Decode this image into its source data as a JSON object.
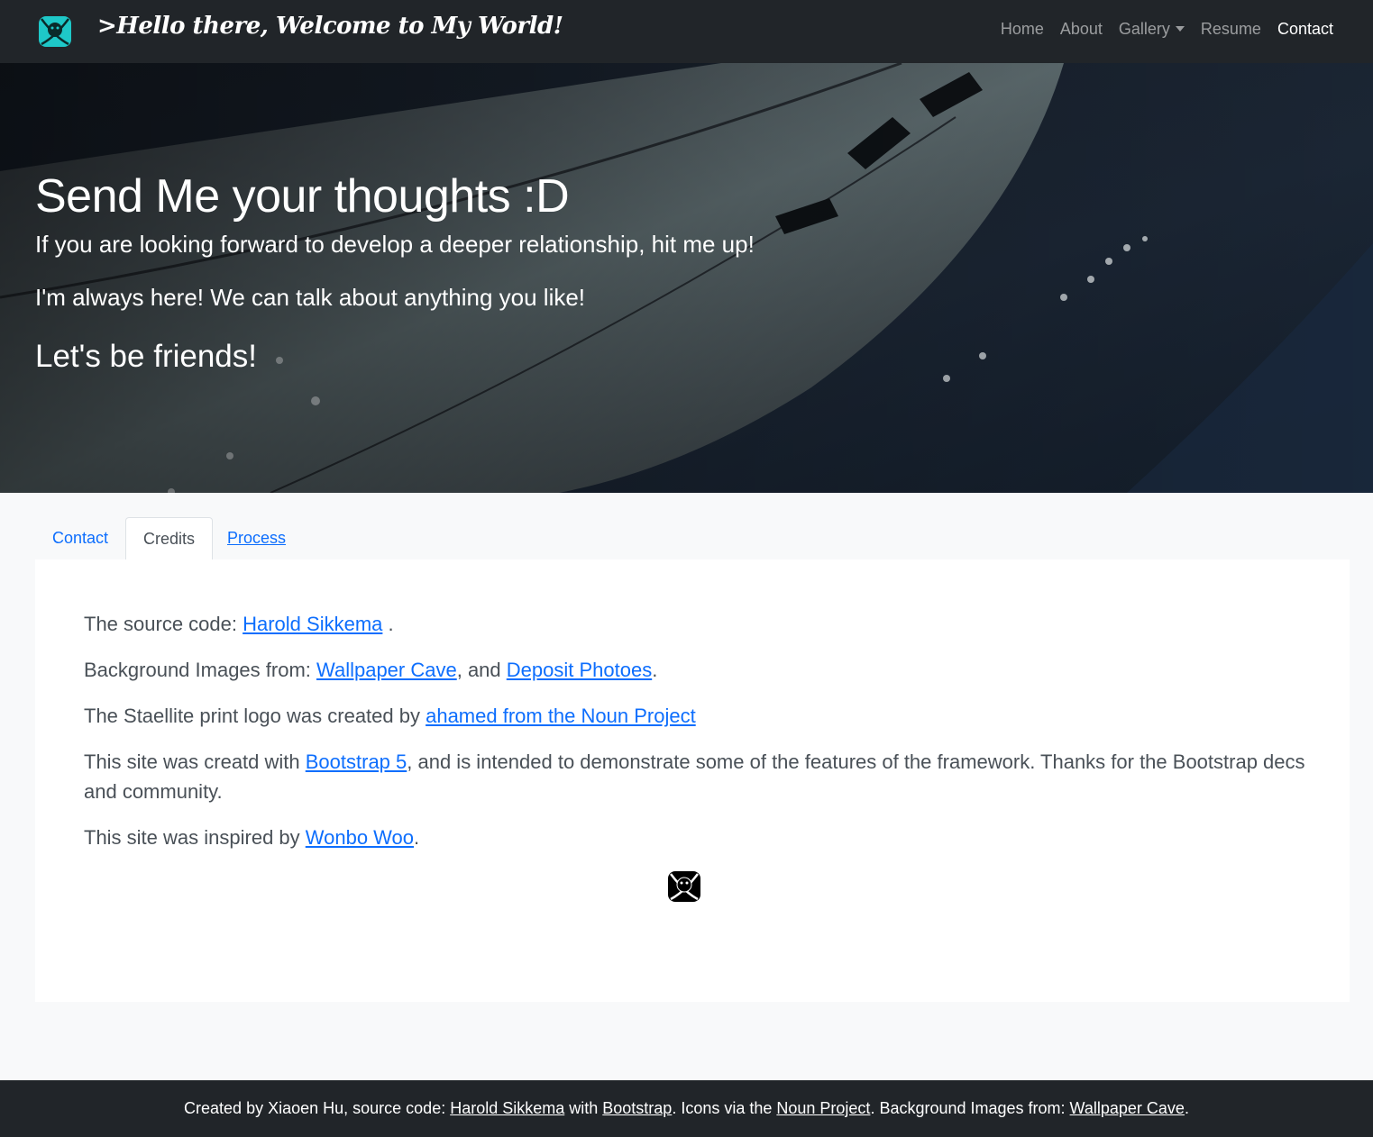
{
  "navbar": {
    "brand": ">Hello there, Welcome to My World!",
    "links": [
      {
        "label": "Home"
      },
      {
        "label": "About"
      },
      {
        "label": "Gallery"
      },
      {
        "label": "Resume"
      },
      {
        "label": "Contact"
      }
    ],
    "active": "Contact"
  },
  "hero": {
    "title": "Send Me your thoughts :D",
    "lead1": "If you are looking forward to develop a deeper relationship, hit me up!",
    "lead2": "I'm always here! We can talk about anything you like!",
    "subtitle": "Let's be friends!"
  },
  "tabs": [
    {
      "label": "Contact"
    },
    {
      "label": "Credits"
    },
    {
      "label": "Process"
    }
  ],
  "active_tab": "Credits",
  "credits": {
    "source_prefix": "The source code: ",
    "source_link": "Harold Sikkema",
    "source_suffix": " .",
    "bg_prefix": "Background Images from: ",
    "bg_link1": "Wallpaper Cave",
    "bg_mid": ", and ",
    "bg_link2": "Deposit Photoes",
    "bg_suffix": ".",
    "logo_prefix": "The Staellite print logo was created by ",
    "logo_link": "ahamed from the Noun Project",
    "bs_prefix": "This site was creatd with ",
    "bs_link": "Bootstrap 5",
    "bs_suffix": ", and is intended to demonstrate some of the features of the framework. Thanks for the Bootstrap decs and community.",
    "inspired_prefix": "This site was inspired by ",
    "inspired_link": "Wonbo Woo",
    "inspired_suffix": "."
  },
  "footer": {
    "p1": "Created by Xiaoen Hu, source code: ",
    "l1": "Harold Sikkema",
    "p2": " with ",
    "l2": "Bootstrap",
    "p3": ". Icons via the ",
    "l3": "Noun Project",
    "p4": ". Background Images from: ",
    "l4": "Wallpaper Cave",
    "p5": "."
  },
  "colors": {
    "navbar_bg": "#212529",
    "logo_teal": "#1ec8c8",
    "link_blue": "#0d6efd",
    "page_bg": "#f8f9fa"
  },
  "icons": [
    "satellite-logo-icon",
    "dropdown-caret-icon"
  ]
}
